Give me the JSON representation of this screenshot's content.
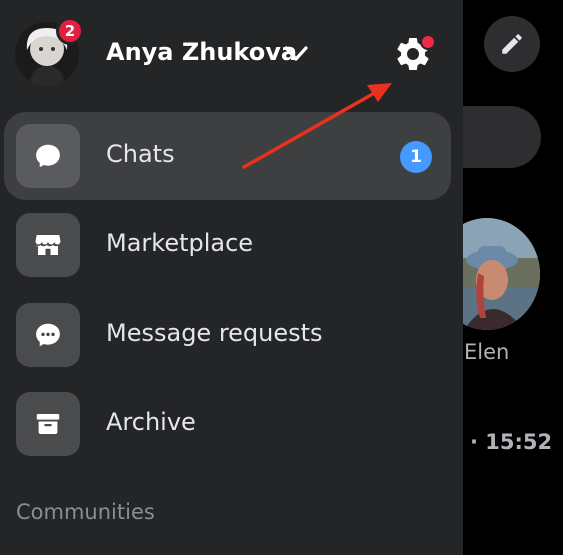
{
  "header": {
    "user_name": "Anya Zhukova",
    "notification_count": "2"
  },
  "menu": {
    "items": [
      {
        "label": "Chats",
        "badge": "1",
        "icon": "chat-bubble-icon",
        "active": true
      },
      {
        "label": "Marketplace",
        "icon": "storefront-icon"
      },
      {
        "label": "Message requests",
        "icon": "message-requests-icon"
      },
      {
        "label": "Archive",
        "icon": "archive-box-icon"
      }
    ],
    "section_label": "Communities"
  },
  "background": {
    "contact_name": "Elen",
    "time_text": "· 15:52"
  },
  "colors": {
    "drawer_bg": "#242526",
    "active_item_bg": "#3e3f41",
    "badge_blue": "#4599ff",
    "badge_red": "#e41e3f",
    "annotation_arrow": "#e8321f"
  }
}
